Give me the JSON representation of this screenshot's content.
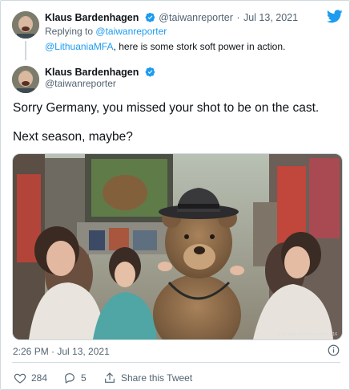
{
  "reply_context": {
    "author_name": "Klaus Bardenhagen",
    "author_handle": "@taiwanreporter",
    "separator": "·",
    "date": "Jul 13, 2021",
    "replying_to_prefix": "Replying to",
    "replying_to_handle": "@taiwanreporter",
    "mention": "@LithuaniaMFA",
    "text": ", here is some stork soft power in action."
  },
  "tweet": {
    "author_name": "Klaus Bardenhagen",
    "author_handle": "@taiwanreporter",
    "line1": "Sorry Germany, you missed your shot to be on the cast.",
    "line2": "Next season, maybe?",
    "image_credit": "© 11 Tabai Perfumed Grams 4/16",
    "timestamp": "2:26 PM · Jul 13, 2021"
  },
  "actions": {
    "like_count": "284",
    "reply_count": "5",
    "share_label": "Share this Tweet"
  },
  "icons": {
    "logo": "twitter-bird-icon",
    "verified": "verified-badge-icon",
    "info": "info-icon",
    "like": "heart-icon",
    "reply": "reply-icon",
    "share": "share-icon"
  },
  "colors": {
    "accent": "#1d9bf0",
    "text": "#0f1419",
    "muted": "#536471",
    "border": "#cfd9de"
  }
}
